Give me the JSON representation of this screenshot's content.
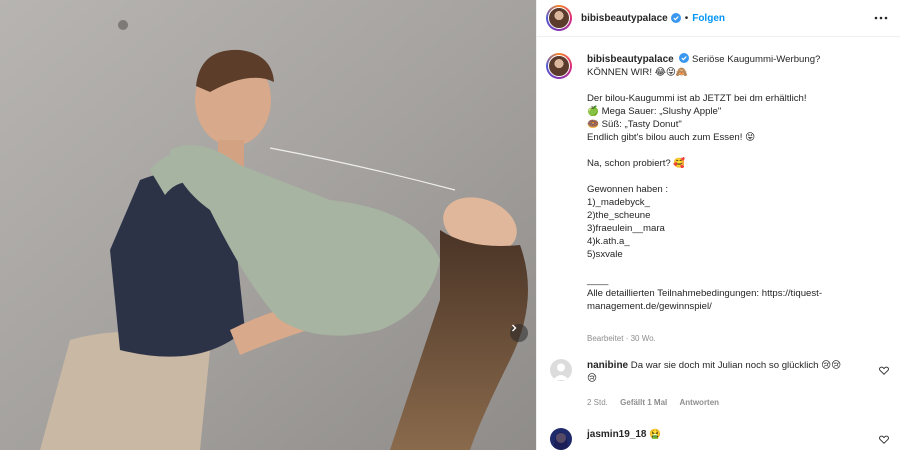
{
  "header": {
    "username": "bibisbeautypalace",
    "separator": "•",
    "follow_label": "Folgen"
  },
  "caption": {
    "username": "bibisbeautypalace",
    "lines": [
      "Seriöse Kaugummi-Werbung?",
      "KÖNNEN WIR! 😂😝🙈",
      "",
      "Der bilou-Kaugummi ist ab JETZT bei dm erhältlich!",
      "🍏 Mega Sauer: „Slushy Apple\"",
      "🍩 Süß: „Tasty Donut\"",
      "Endlich gibt's bilou auch zum Essen! 😝",
      "",
      "Na, schon probiert? 🥰",
      "",
      "Gewonnen haben :",
      "1)_madebyck_",
      "2)the_scheune",
      "3)fraeulein__mara",
      "4)k.ath.a_",
      "5)sxvale",
      "",
      "____",
      "Alle detaillierten Teilnahmebedingungen: https://tiquest-",
      "management.de/gewinnspiel/"
    ],
    "edited": "Bearbeitet · 30 Wo."
  },
  "comments": [
    {
      "username": "nanibine",
      "text": "Da war sie doch mit Julian noch so glücklich 😢😢",
      "text2": "😢",
      "time": "2 Std.",
      "likes": "Gefällt 1 Mal",
      "reply": "Antworten"
    },
    {
      "username": "jasmin19_18",
      "text": "🤮"
    }
  ],
  "icons": {
    "verified": "verified-badge-icon",
    "more": "more-options-icon",
    "next": "chevron-right-icon",
    "heart": "heart-outline-icon"
  },
  "colors": {
    "accent": "#0095f6",
    "verified": "#3897f0",
    "muted": "#8e8e8e"
  }
}
